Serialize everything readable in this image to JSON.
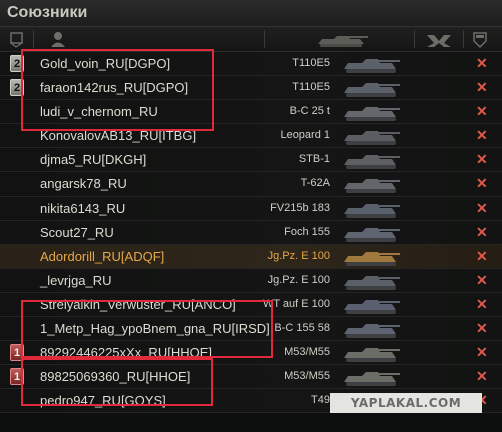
{
  "panel": {
    "title": "Союзники"
  },
  "players": [
    {
      "name": "Gold_voin_RU[DGPO]",
      "vehicle": "T110E5",
      "rank": "2"
    },
    {
      "name": "faraon142rus_RU[DGPO]",
      "vehicle": "T110E5",
      "rank": "2"
    },
    {
      "name": "ludi_v_chernom_RU",
      "vehicle": "B-C 25 t",
      "rank": ""
    },
    {
      "name": "KonovalovAB13_RU[ITBG]",
      "vehicle": "Leopard 1",
      "rank": ""
    },
    {
      "name": "djma5_RU[DKGH]",
      "vehicle": "STB-1",
      "rank": ""
    },
    {
      "name": "angarsk78_RU",
      "vehicle": "T-62A",
      "rank": ""
    },
    {
      "name": "nikita6143_RU",
      "vehicle": "FV215b 183",
      "rank": ""
    },
    {
      "name": "Scout27_RU",
      "vehicle": "Foch 155",
      "rank": ""
    },
    {
      "name": "Adordorill_RU[ADQF]",
      "vehicle": "Jg.Pz. E 100",
      "rank": ""
    },
    {
      "name": "_levrjga_RU",
      "vehicle": "Jg.Pz. E 100",
      "rank": ""
    },
    {
      "name": "Strelyalkin_Verwuster_RU[ANCO]",
      "vehicle": "WT auf E 100",
      "rank": ""
    },
    {
      "name": "1_Metp_Hag_ypoBnem_gna_RU[IRSD]",
      "vehicle": "B-C 155 58",
      "rank": ""
    },
    {
      "name": "89292446225xXx_RU[HHOE]",
      "vehicle": "M53/M55",
      "rank": "1"
    },
    {
      "name": "89825069360_RU[HHOE]",
      "vehicle": "M53/M55",
      "rank": "1"
    },
    {
      "name": "pedro947_RU[GOYS]",
      "vehicle": "T49",
      "rank": ""
    }
  ],
  "dead_mark": "✕",
  "watermark": "YAPLAKAL.COM",
  "colors": {
    "highlight_player": "#e6a84a",
    "dead_mark": "#e05a4c",
    "annotation_box": "#e0293a"
  }
}
